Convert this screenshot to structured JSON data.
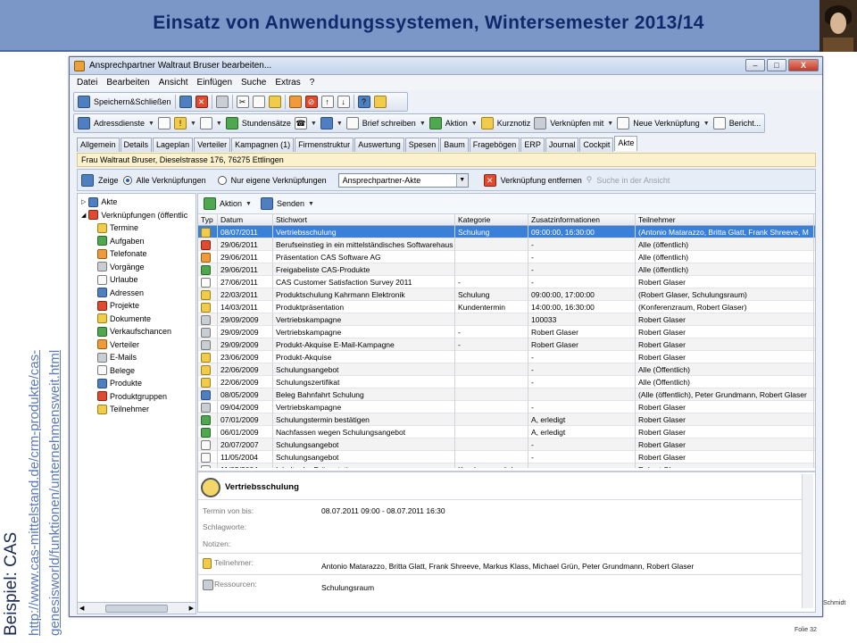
{
  "slide": {
    "title": "Einsatz von Anwendungssystemen, Wintersemester 2013/14",
    "side_title": "Beispiel: CAS",
    "link_line1": "http://www.cas-mittelstand.de/crm-produkte/cas-",
    "link_line2": "genesisworld/funktionen/unternehmensweit.html",
    "footer_name": "Schmidt",
    "footer_page": "Folie 32"
  },
  "window": {
    "title": "Ansprechpartner Waltraut Bruser bearbeiten...",
    "buttons": {
      "minimize": "–",
      "maximize": "□",
      "close": "X"
    }
  },
  "menu": [
    "Datei",
    "Bearbeiten",
    "Ansicht",
    "Einfügen",
    "Suche",
    "Extras",
    "?"
  ],
  "toolbar1": {
    "save_close": "Speichern&Schließen"
  },
  "toolbar2": {
    "adressdienste": "Adressdienste",
    "stundensaetze": "Stundensätze",
    "brief": "Brief schreiben",
    "aktion": "Aktion",
    "kurznotiz": "Kurznotiz",
    "verknuepfen": "Verknüpfen mit",
    "neue_verkn": "Neue Verknüpfung",
    "bericht": "Bericht..."
  },
  "tabs": [
    "Allgemein",
    "Details",
    "Lageplan",
    "Verteiler",
    "Kampagnen (1)",
    "Firmenstruktur",
    "Auswertung",
    "Spesen",
    "Baum",
    "Fragebögen",
    "ERP",
    "Journal",
    "Cockpit",
    "Akte"
  ],
  "infobar": "Frau Waltraut Bruser,  Dieselstrasse 176,  76275 Ettlingen",
  "filter": {
    "zeige": "Zeige",
    "alle": "Alle Verknüpfungen",
    "eigene": "Nur eigene Verknüpfungen",
    "combo_value": "Ansprechpartner-Akte",
    "entfernen": "Verknüpfung entfernen",
    "suche": "Suche in der Ansicht"
  },
  "tree": [
    {
      "label": "Akte",
      "indent": 0
    },
    {
      "label": "Verknüpfungen (öffentlic",
      "indent": 0
    },
    {
      "label": "Termine",
      "indent": 1
    },
    {
      "label": "Aufgaben",
      "indent": 1
    },
    {
      "label": "Telefonate",
      "indent": 1
    },
    {
      "label": "Vorgänge",
      "indent": 1
    },
    {
      "label": "Urlaube",
      "indent": 1
    },
    {
      "label": "Adressen",
      "indent": 1
    },
    {
      "label": "Projekte",
      "indent": 1
    },
    {
      "label": "Dokumente",
      "indent": 1
    },
    {
      "label": "Verkaufschancen",
      "indent": 1
    },
    {
      "label": "Verteiler",
      "indent": 1
    },
    {
      "label": "E-Mails",
      "indent": 1
    },
    {
      "label": "Belege",
      "indent": 1
    },
    {
      "label": "Produkte",
      "indent": 1
    },
    {
      "label": "Produktgruppen",
      "indent": 1
    },
    {
      "label": "Teilnehmer",
      "indent": 1
    }
  ],
  "subtoolbar": {
    "aktion": "Aktion",
    "senden": "Senden"
  },
  "table": {
    "headers": [
      "Typ",
      "Datum",
      "Stichwort",
      "Kategorie",
      "Zusatzinformationen",
      "Teilnehmer"
    ],
    "rows": [
      [
        "08/07/2011",
        "Vertriebsschulung",
        "Schulung",
        "09:00:00, 16:30:00",
        "(Antonio Matarazzo, Britta Glatt, Frank Shreeve, M"
      ],
      [
        "29/06/2011",
        "Berufseinstieg in ein mittelständisches Softwarehaus",
        "",
        "-",
        "Alle (öffentlich)"
      ],
      [
        "29/06/2011",
        "Präsentation CAS Software AG",
        "",
        "-",
        "Alle (öffentlich)"
      ],
      [
        "29/06/2011",
        "Freigabeliste CAS-Produkte",
        "",
        "-",
        "Alle (öffentlich)"
      ],
      [
        "27/06/2011",
        "CAS Customer Satisfaction Survey 2011",
        "-",
        "-",
        "Robert Glaser"
      ],
      [
        "22/03/2011",
        "Produktschulung Kahrmann Elektronik",
        "Schulung",
        "09:00:00, 17:00:00",
        "(Robert Glaser, Schulungsraum)"
      ],
      [
        "14/03/2011",
        "Produktpräsentation",
        "Kundentermin",
        "14:00:00, 16:30:00",
        "(Konferenzraum, Robert Glaser)"
      ],
      [
        "29/09/2009",
        "Vertriebskampagne",
        "",
        "100033",
        "Robert Glaser"
      ],
      [
        "29/09/2009",
        "Vertriebskampagne",
        "-",
        "Robert Glaser",
        "Robert Glaser"
      ],
      [
        "29/09/2009",
        "Produkt-Akquise E-Mail-Kampagne",
        "-",
        "Robert Glaser",
        "Robert Glaser"
      ],
      [
        "23/06/2009",
        "Produkt-Akquise",
        "",
        "-",
        "Robert Glaser"
      ],
      [
        "22/06/2009",
        "Schulungsangebot",
        "",
        "-",
        "Alle (Öffentlich)"
      ],
      [
        "22/06/2009",
        "Schulungszertifikat",
        "",
        "-",
        "Alle (Öffentlich)"
      ],
      [
        "08/05/2009",
        "Beleg Bahnfahrt Schulung",
        "",
        "",
        "(Alle (öffentlich), Peter Grundmann, Robert Glaser"
      ],
      [
        "09/04/2009",
        "Vertriebskampagne",
        "",
        "-",
        "Robert Glaser"
      ],
      [
        "07/01/2009",
        "Schulungstermin bestätigen",
        "",
        "A, erledigt",
        "Robert Glaser"
      ],
      [
        "06/01/2009",
        "Nachfassen wegen Schulungsangebot",
        "",
        "A, erledigt",
        "Robert Glaser"
      ],
      [
        "20/07/2007",
        "Schulungsangebot",
        "",
        "-",
        "Robert Glaser"
      ],
      [
        "11/05/2004",
        "Schulungsangebot",
        "",
        "-",
        "Robert Glaser"
      ],
      [
        "11/05/2004",
        "Inhalte der Präsentation",
        "Kundengespräch",
        "-",
        "Robert Glaser"
      ]
    ],
    "type_icons": [
      "clock-icon",
      "pdf-icon",
      "powerpoint-icon",
      "excel-icon",
      "form-icon",
      "clock-icon",
      "clock-icon",
      "campaign-icon",
      "campaign-icon",
      "campaign-icon",
      "document-icon",
      "document-icon",
      "document-icon",
      "word-icon",
      "campaign-icon",
      "task-icon",
      "task-icon",
      "phone-icon",
      "phone-icon",
      "phone-icon"
    ]
  },
  "detail": {
    "title": "Vertriebsschulung",
    "termin_label": "Termin von bis:",
    "termin_value": "08.07.2011 09:00 - 08.07.2011 16:30",
    "schlagworte_label": "Schlagworte:",
    "notizen_label": "Notizen:",
    "teilnehmer_label": "Teilnehmer:",
    "teilnehmer_value": "Antonio Matarazzo, Britta Glatt, Frank Shreeve, Markus Klass, Michael Grün, Peter Grundmann, Robert Glaser",
    "ressourcen_label": "Ressourcen:",
    "ressourcen_value": "Schulungsraum"
  }
}
